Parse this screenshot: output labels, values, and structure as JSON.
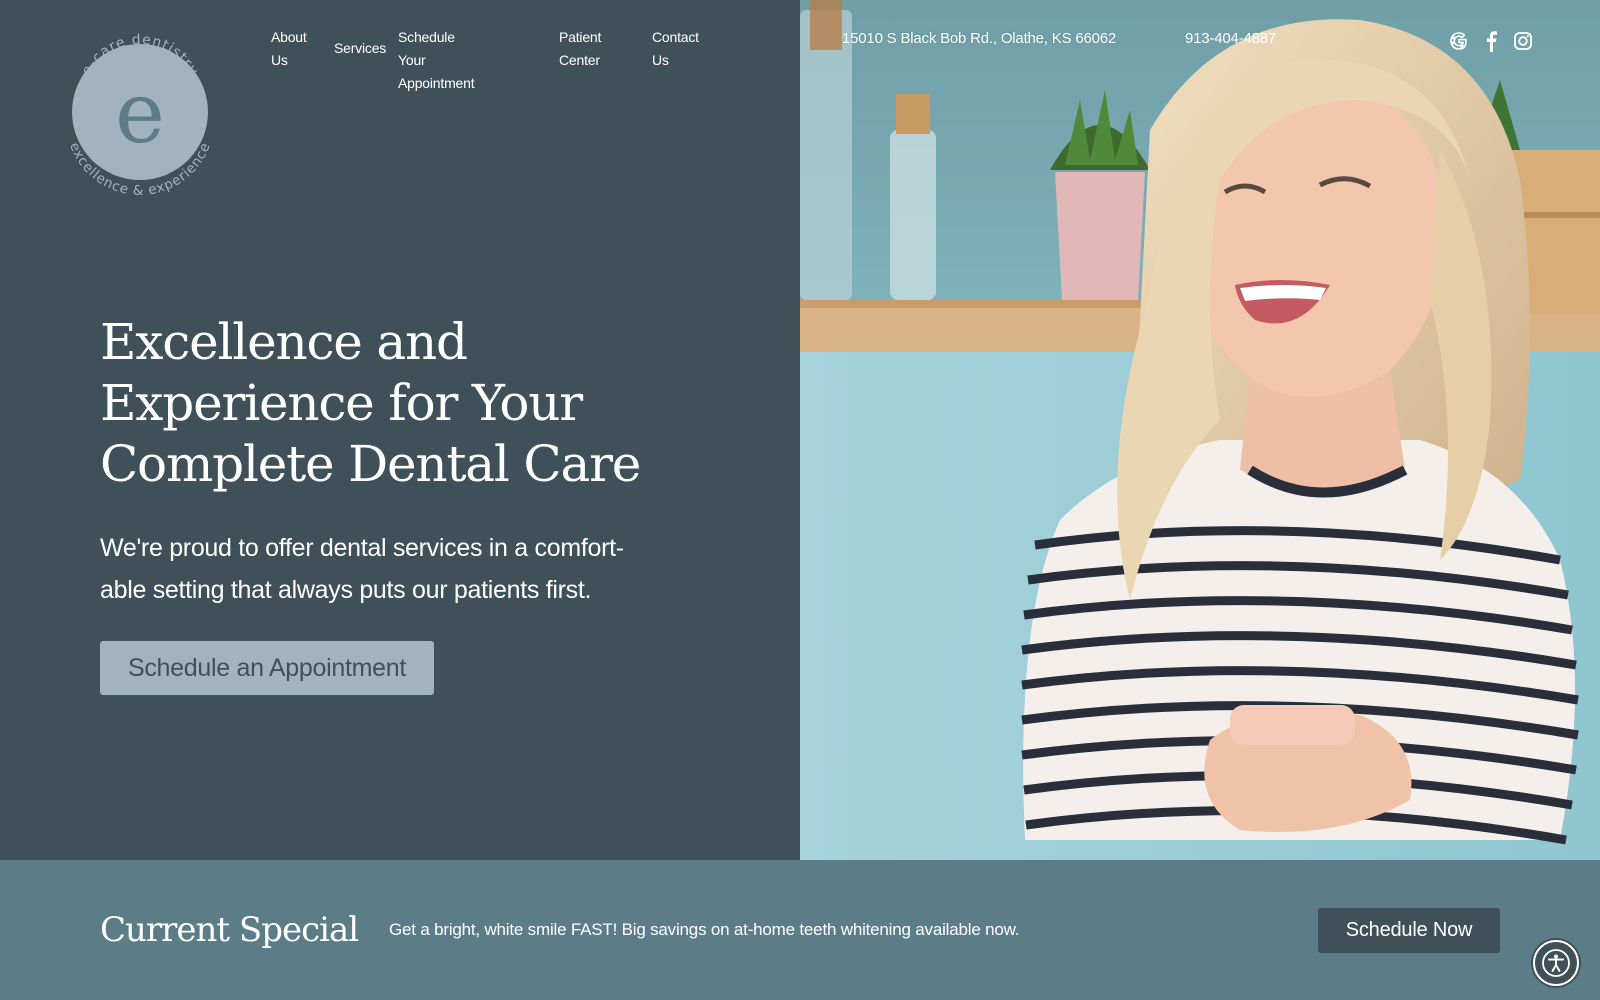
{
  "logo": {
    "letter": "e",
    "top_text": "e-care dentistry",
    "bottom_text": "excellence & experience"
  },
  "nav": {
    "items": [
      {
        "line1": "About",
        "line2": "Us"
      },
      {
        "line1": "Services",
        "line2": ""
      },
      {
        "line1": "Schedule Your",
        "line2": "Appointment"
      },
      {
        "line1": "Patient",
        "line2": "Center"
      },
      {
        "line1": "Contact",
        "line2": "Us"
      }
    ]
  },
  "contact": {
    "address": "15010 S Black Bob Rd., Olathe, KS 66062",
    "phone": "913-404-4887"
  },
  "social": {
    "icons": [
      "google-icon",
      "facebook-icon",
      "instagram-icon"
    ]
  },
  "hero": {
    "title": "Excellence and Experience for Your Complete Dental Care",
    "subtitle_line1": "We're proud to offer dental services in a comfort-",
    "subtitle_line2": "able setting that always puts our patients first.",
    "cta": "Schedule an Appointment"
  },
  "special": {
    "title": "Current Special",
    "text": "Get a bright, white smile FAST! Big savings on at-home teeth whitening available now.",
    "button": "Schedule Now"
  },
  "colors": {
    "panel": "#3f5059",
    "bar": "#5c7d88",
    "button_light": "#a1b3be"
  }
}
